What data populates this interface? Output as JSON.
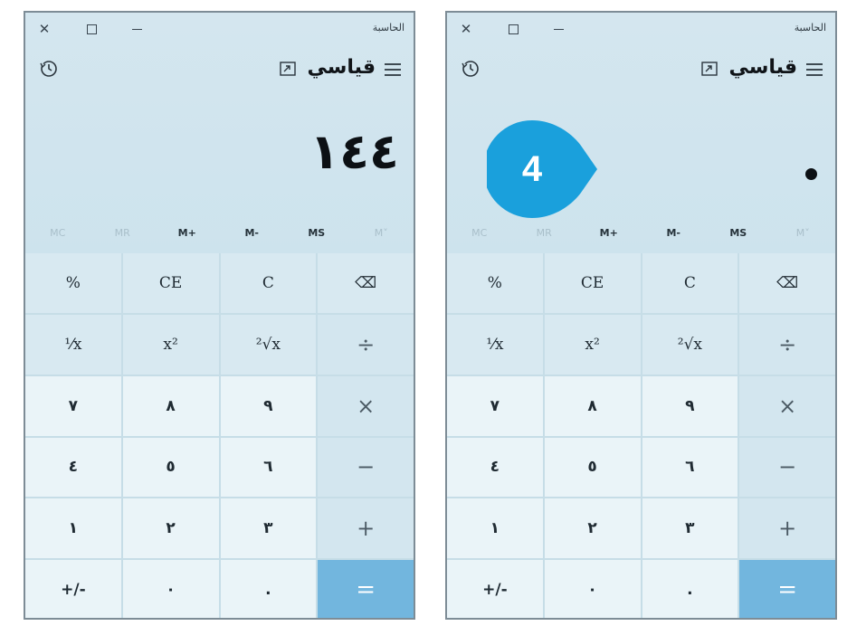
{
  "left": {
    "app_title": "الحاسبة",
    "mode_title": "قياسي",
    "display_value": "١٤٤",
    "memory": [
      {
        "label": "MC",
        "enabled": false
      },
      {
        "label": "MR",
        "enabled": false
      },
      {
        "label": "M+",
        "enabled": true
      },
      {
        "label": "M-",
        "enabled": true
      },
      {
        "label": "MS",
        "enabled": true
      },
      {
        "label": "M˅",
        "enabled": false
      }
    ]
  },
  "right": {
    "app_title": "الحاسبة",
    "mode_title": "قياسي",
    "display_value": "",
    "memory": [
      {
        "label": "MC",
        "enabled": false
      },
      {
        "label": "MR",
        "enabled": false
      },
      {
        "label": "M+",
        "enabled": true
      },
      {
        "label": "M-",
        "enabled": true
      },
      {
        "label": "MS",
        "enabled": true
      },
      {
        "label": "M˅",
        "enabled": false
      }
    ]
  },
  "keys": [
    {
      "label": "%",
      "type": "fn",
      "name": "percent-key"
    },
    {
      "label": "CE",
      "type": "fn",
      "name": "clear-entry-key"
    },
    {
      "label": "C",
      "type": "fn",
      "name": "clear-key"
    },
    {
      "label": "⌫",
      "type": "fn",
      "name": "backspace-key"
    },
    {
      "label": "⅟x",
      "type": "fn",
      "name": "reciprocal-key"
    },
    {
      "label": "x²",
      "type": "fn",
      "name": "square-key"
    },
    {
      "label": "²√x",
      "type": "fn",
      "name": "square-root-key"
    },
    {
      "label": "÷",
      "type": "op",
      "name": "divide-key"
    },
    {
      "label": "٧",
      "type": "num",
      "name": "digit-7-key"
    },
    {
      "label": "٨",
      "type": "num",
      "name": "digit-8-key"
    },
    {
      "label": "٩",
      "type": "num",
      "name": "digit-9-key"
    },
    {
      "label": "×",
      "type": "op",
      "name": "multiply-key"
    },
    {
      "label": "٤",
      "type": "num",
      "name": "digit-4-key"
    },
    {
      "label": "٥",
      "type": "num",
      "name": "digit-5-key"
    },
    {
      "label": "٦",
      "type": "num",
      "name": "digit-6-key"
    },
    {
      "label": "−",
      "type": "op",
      "name": "subtract-key"
    },
    {
      "label": "١",
      "type": "num",
      "name": "digit-1-key"
    },
    {
      "label": "٢",
      "type": "num",
      "name": "digit-2-key"
    },
    {
      "label": "٣",
      "type": "num",
      "name": "digit-3-key"
    },
    {
      "label": "+",
      "type": "op",
      "name": "add-key"
    },
    {
      "label": "+/-",
      "type": "num",
      "name": "negate-key"
    },
    {
      "label": "٠",
      "type": "num",
      "name": "digit-0-key"
    },
    {
      "label": ".",
      "type": "num",
      "name": "decimal-key"
    },
    {
      "label": "=",
      "type": "eq",
      "name": "equals-key"
    }
  ],
  "step_badge": {
    "number": "4",
    "color": "#1aa0dc"
  },
  "colors": {
    "accent_equals": "#72b6de"
  }
}
